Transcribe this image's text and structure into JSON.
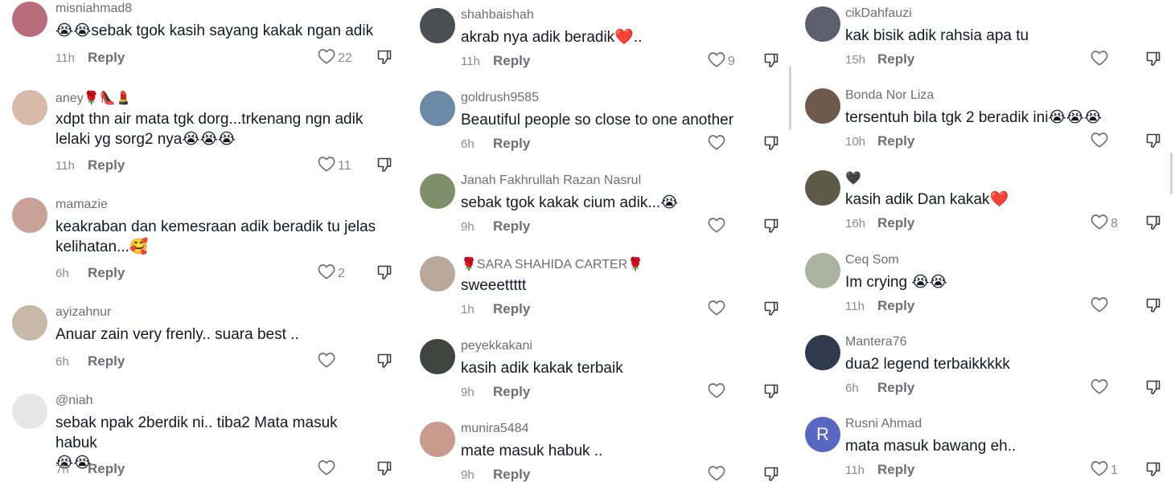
{
  "reply_label": "Reply",
  "columns": [
    {
      "comments": [
        {
          "username": "misniahmad8",
          "text": "😭😭sebak tgok kasih sayang kakak ngan adik",
          "time": "11h",
          "likes": "22",
          "avatar_color": "#b86d7a"
        },
        {
          "username": "aney🌹👠💄",
          "text": "xdpt thn air mata tgk dorg...trkenang ngn adik\nlelaki yg sorg2 nya😭😭😭",
          "time": "11h",
          "likes": "11",
          "avatar_color": "#d9b9a7"
        },
        {
          "username": "mamazie",
          "text": "keakraban dan kemesraan adik beradik tu jelas\nkelihatan...🥰",
          "time": "6h",
          "likes": "2",
          "avatar_color": "#c9a196"
        },
        {
          "username": "ayizahnur",
          "text": "Anuar zain very frenly.. suara best ..",
          "time": "6h",
          "likes": "",
          "avatar_color": "#c7b8a8"
        },
        {
          "username": "@niah",
          "text": "sebak npak 2berdik ni.. tiba2 Mata masuk habuk\n😭😭",
          "time": "7h",
          "likes": "",
          "avatar_color": "#e6e6e6"
        }
      ]
    },
    {
      "comments": [
        {
          "username": "shahbaishah",
          "text": "akrab nya adik beradik❤️..",
          "time": "11h",
          "likes": "9",
          "avatar_color": "#4a4f55"
        },
        {
          "username": "goldrush9585",
          "text": "Beautiful people so close to one another",
          "time": "6h",
          "likes": "",
          "avatar_color": "#6b8aa6"
        },
        {
          "username": "Janah Fakhrullah Razan Nasrul",
          "text": "sebak tgok kakak cium adik...😭",
          "time": "9h",
          "likes": "",
          "avatar_color": "#7e8f6b"
        },
        {
          "username": "🌹SARA SHAHIDA CARTER🌹",
          "text": "sweeettttt",
          "time": "1h",
          "likes": "",
          "avatar_color": "#b8a79a"
        },
        {
          "username": "peyekkakani",
          "text": "kasih adik kakak terbaik",
          "time": "9h",
          "likes": "",
          "avatar_color": "#3f4540"
        },
        {
          "username": "munira5484",
          "text": "mate masuk habuk ..",
          "time": "9h",
          "likes": "",
          "avatar_color": "#c99a8e"
        }
      ]
    },
    {
      "comments": [
        {
          "username": "cikDahfauzi",
          "text": "kak bisik adik rahsia apa tu",
          "time": "15h",
          "likes": "",
          "avatar_color": "#5b5f6e"
        },
        {
          "username": "Bonda Nor Liza",
          "text": "tersentuh bila tgk 2 beradik ini😭😭😭",
          "time": "10h",
          "likes": "",
          "avatar_color": "#6e5a4c"
        },
        {
          "username": "🖤",
          "text": "kasih adik Dan kakak❤️",
          "time": "16h",
          "likes": "8",
          "avatar_color": "#5e5a48"
        },
        {
          "username": "Ceq Som",
          "text": "Im crying 😭😭",
          "time": "11h",
          "likes": "",
          "avatar_color": "#a8b3a0"
        },
        {
          "username": "Mantera76",
          "text": "dua2 legend terbaikkkkk",
          "time": "6h",
          "likes": "",
          "avatar_color": "#2f3a4d"
        },
        {
          "username": "Rusni Ahmad",
          "text": "mata masuk bawang eh..",
          "time": "11h",
          "likes": "1",
          "avatar_letter": "R",
          "avatar_color": "#5a67c2"
        }
      ]
    }
  ],
  "icons": {
    "like": "heart-outline-icon",
    "dislike": "thumbs-down-icon"
  }
}
